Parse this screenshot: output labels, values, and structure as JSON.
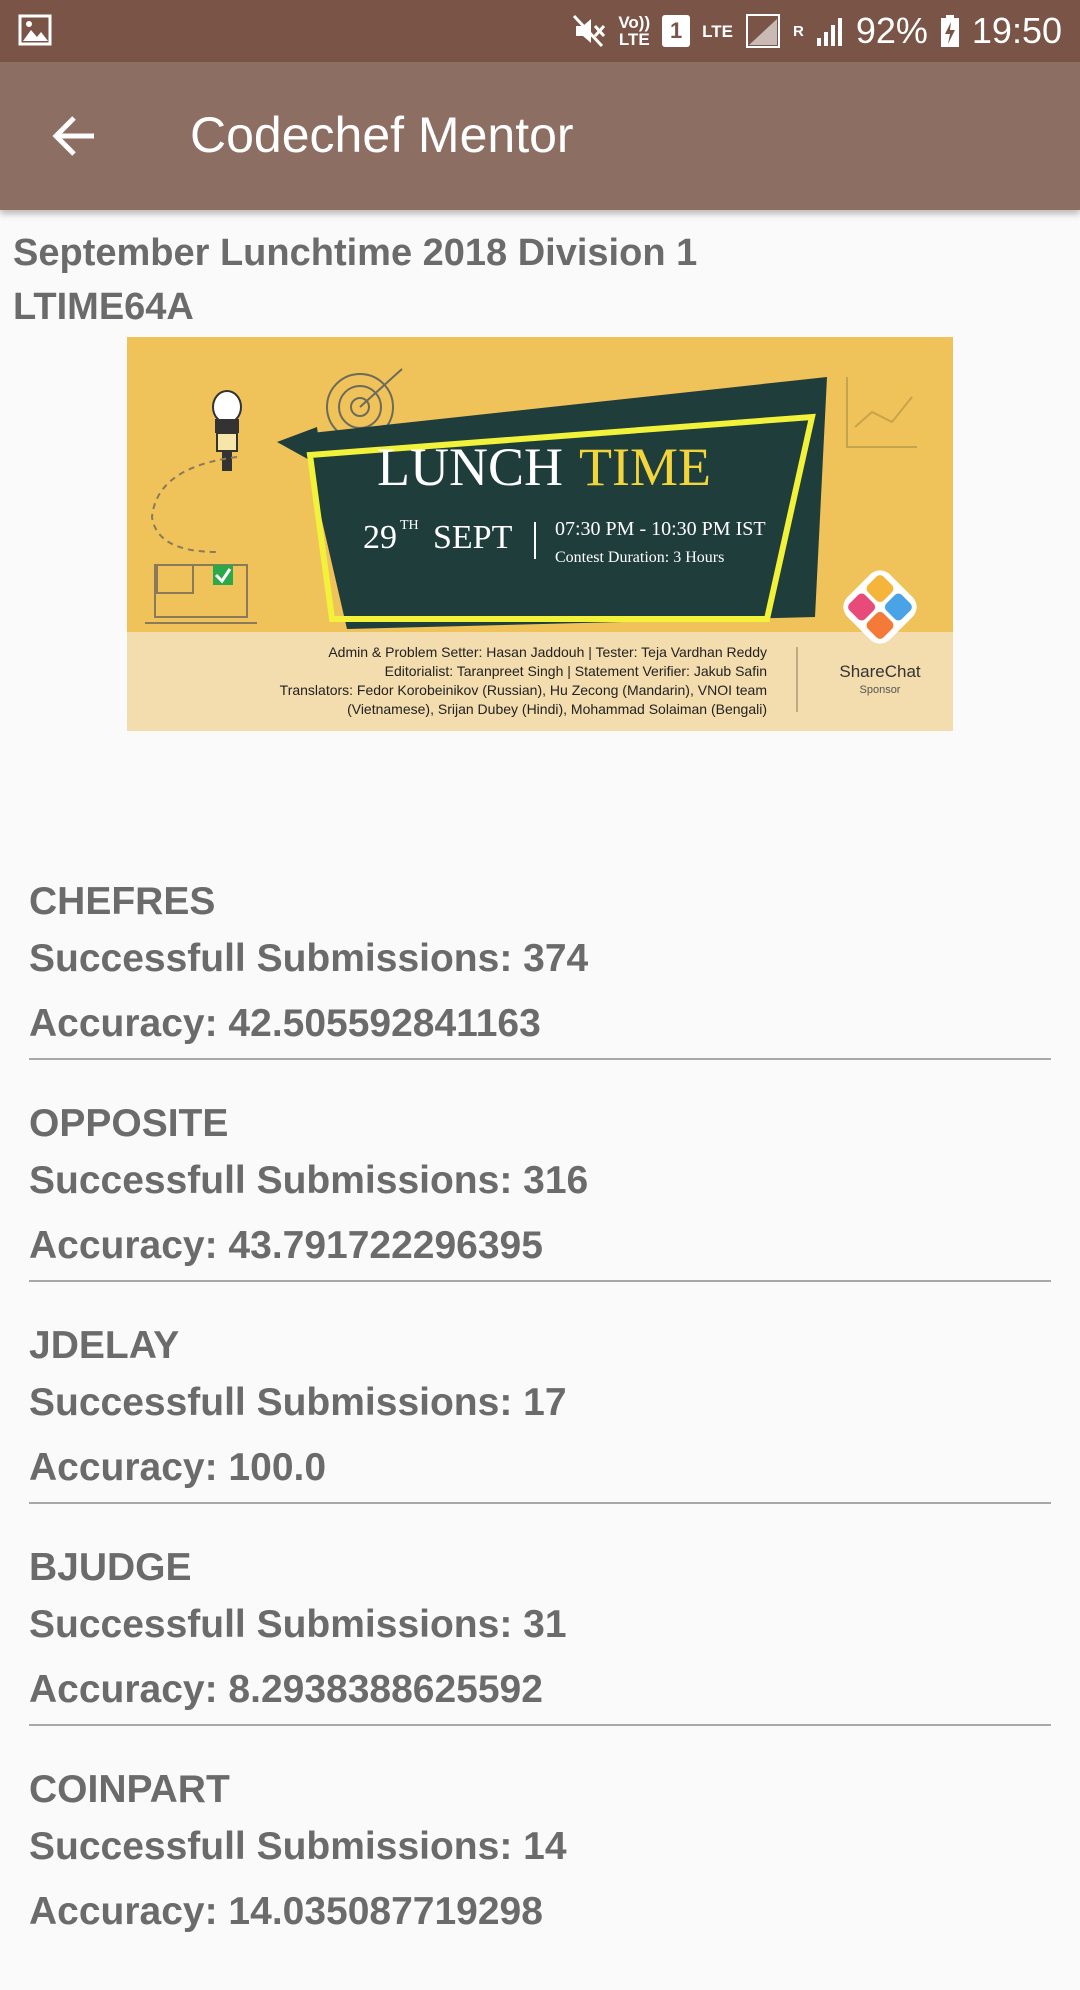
{
  "status_bar": {
    "volte_top": "Vo))",
    "volte_bottom": "LTE",
    "sim": "1",
    "lte": "LTE",
    "roaming": "R",
    "battery": "92%",
    "time": "19:50"
  },
  "app_bar": {
    "title": "Codechef Mentor"
  },
  "contest": {
    "name": "September Lunchtime 2018 Division 1",
    "code": "LTIME64A"
  },
  "banner": {
    "title_white": "LUNCH",
    "title_yellow": "TIME",
    "date_day": "29",
    "date_suffix": "TH",
    "date_month": "SEPT",
    "time_range": "07:30 PM - 10:30 PM IST",
    "duration": "Contest Duration:  3 Hours",
    "credits_line1": "Admin & Problem Setter: Hasan Jaddouh | Tester: Teja Vardhan Reddy",
    "credits_line2": "Editorialist: Taranpreet Singh | Statement Verifier: Jakub Safin",
    "credits_line3": "Translators: Fedor Korobeinikov (Russian), Hu Zecong (Mandarin), VNOI team",
    "credits_line4": "(Vietnamese), Srijan Dubey (Hindi), Mohammad Solaiman (Bengali)",
    "sponsor_name": "ShareChat",
    "sponsor_label": "Sponsor",
    "colors": {
      "background": "#f0c25a",
      "board": "#1f3e3b",
      "frame": "#f2f23a",
      "credits_bg": "#f3dcae"
    }
  },
  "problems": [
    {
      "code": "CHEFRES",
      "submissions": "Successfull Submissions: 374",
      "accuracy": "Accuracy: 42.505592841163"
    },
    {
      "code": "OPPOSITE",
      "submissions": "Successfull Submissions: 316",
      "accuracy": "Accuracy: 43.791722296395"
    },
    {
      "code": "JDELAY",
      "submissions": "Successfull Submissions: 17",
      "accuracy": "Accuracy: 100.0"
    },
    {
      "code": "BJUDGE",
      "submissions": "Successfull Submissions: 31",
      "accuracy": "Accuracy: 8.2938388625592"
    },
    {
      "code": "COINPART",
      "submissions": "Successfull Submissions: 14",
      "accuracy": "Accuracy: 14.035087719298"
    }
  ],
  "icons": [
    "gallery-icon",
    "mute-icon",
    "signal-icon",
    "battery-icon",
    "back-arrow-icon"
  ]
}
